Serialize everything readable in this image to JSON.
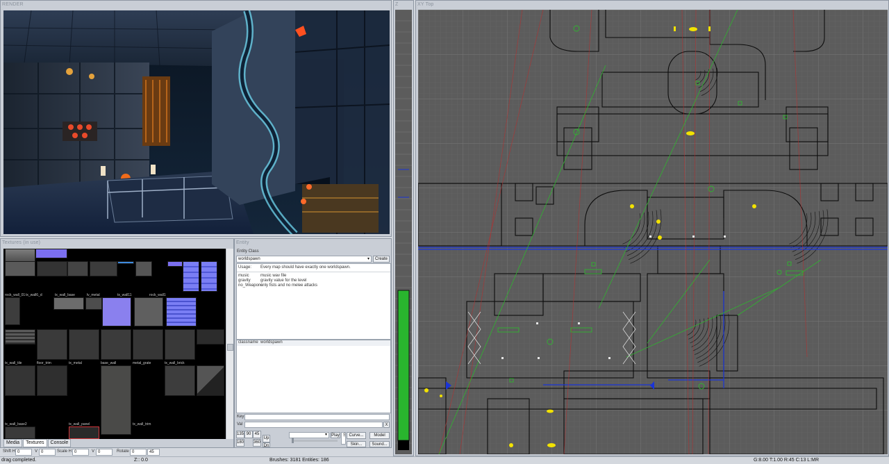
{
  "panes": {
    "render_title": "RENDER",
    "textures_title": "Textures (in use)",
    "entity_title": "Entity",
    "z_title": "Z",
    "xy_title": "XY Top"
  },
  "textures": {
    "tabs": [
      "Media",
      "Textures",
      "Console"
    ],
    "active_tab": "Textures",
    "labels": [
      "rock_wall_01",
      "tx_wall6_d",
      "tx_wall_base",
      "lv_metal",
      "tx_wall11",
      "rock_wall1",
      "tx_wall_tile",
      "floor_trim",
      "tx_metal",
      "base_wall",
      "metal_grate",
      "tx_wall_brick",
      "tx_wall_base2",
      "tx_wall_panel",
      "tx_wall_trim"
    ]
  },
  "entity": {
    "class_label": "Entity Class",
    "class_value": "worldspawn",
    "create_button": "Create",
    "description": [
      {
        "key": "Usage:",
        "text": "Every map should have exactly one worldspawn."
      },
      {
        "key": "music",
        "text": "music wav file"
      },
      {
        "key": "gravity",
        "text": "gravity value for the level"
      },
      {
        "key": "no_Weapons",
        "text": "only fists and no melee attacks"
      }
    ],
    "keyvalues": [
      {
        "key": "classname",
        "value": "worldspawn"
      }
    ],
    "key_label": "Key",
    "val_label": "Val",
    "clear_button": "X",
    "angles": [
      "135",
      "90",
      "45",
      "180",
      "360"
    ],
    "up_button": "Up",
    "dn_button": "Dn",
    "play_button": "Play",
    "curve_button": "Curve...",
    "model_button": "Model",
    "skin_button": "Skin...",
    "sound_button": "Sound...",
    "speaker_value": "S"
  },
  "transform": {
    "shift_h_label": "Shift H",
    "shift_h": "0",
    "v1_label": "V",
    "v1": "0",
    "scale_h_label": "Scale H",
    "scale_h": "0",
    "v2_label": "V",
    "v2": "0",
    "rotate_label": "Rotate",
    "rotate": "0",
    "rotate_step": "45"
  },
  "status": {
    "message": "drag completed.",
    "z": "Z:: 0.0",
    "brushes": "Brushes: 3181 Entities: 186",
    "grid": "G:8.00 T:1.00 R:45 C:13 L:MR"
  },
  "colors": {
    "xy_bg": "#5c5c5c",
    "brush_line": "#0d0d0d",
    "selected_green": "#2fb52f",
    "entity_yellow": "#f2e200",
    "player_blue": "#1a34d8",
    "z_green": "#29b52e"
  }
}
